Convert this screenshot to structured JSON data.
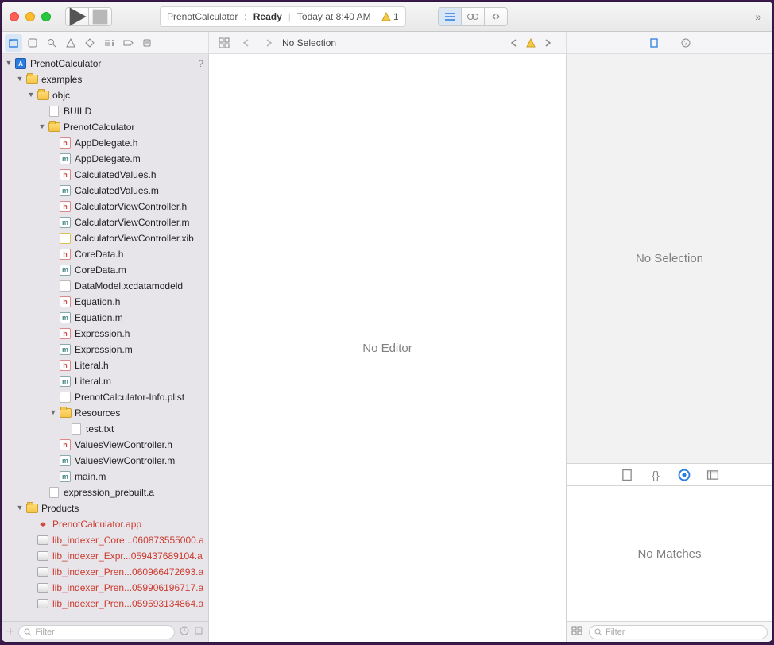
{
  "titlebar": {
    "project": "PrenotCalculator",
    "status": "Ready",
    "timestamp": "Today at 8:40 AM",
    "warning_count": "1"
  },
  "jumpbar": {
    "no_selection": "No Selection"
  },
  "editor": {
    "placeholder": "No Editor"
  },
  "inspector": {
    "no_selection": "No Selection",
    "no_matches": "No Matches"
  },
  "filter": {
    "placeholder": "Filter"
  },
  "tree": {
    "root": "PrenotCalculator",
    "examples": "examples",
    "objc": "objc",
    "build": "BUILD",
    "pc_folder": "PrenotCalculator",
    "files": {
      "appdelegate_h": "AppDelegate.h",
      "appdelegate_m": "AppDelegate.m",
      "calcvalues_h": "CalculatedValues.h",
      "calcvalues_m": "CalculatedValues.m",
      "cvc_h": "CalculatorViewController.h",
      "cvc_m": "CalculatorViewController.m",
      "cvc_xib": "CalculatorViewController.xib",
      "coredata_h": "CoreData.h",
      "coredata_m": "CoreData.m",
      "datamodel": "DataModel.xcdatamodeld",
      "equation_h": "Equation.h",
      "equation_m": "Equation.m",
      "expression_h": "Expression.h",
      "expression_m": "Expression.m",
      "literal_h": "Literal.h",
      "literal_m": "Literal.m",
      "info_plist": "PrenotCalculator-Info.plist",
      "resources": "Resources",
      "test_txt": "test.txt",
      "vvc_h": "ValuesViewController.h",
      "vvc_m": "ValuesViewController.m",
      "main_m": "main.m",
      "expr_prebuilt": "expression_prebuilt.a"
    },
    "products": "Products",
    "product_items": {
      "app": "PrenotCalculator.app",
      "lib1": "lib_indexer_Core...060873555000.a",
      "lib2": "lib_indexer_Expr...059437689104.a",
      "lib3": "lib_indexer_Pren...060966472693.a",
      "lib4": "lib_indexer_Pren...059906196717.a",
      "lib5": "lib_indexer_Pren...059593134864.a"
    }
  }
}
